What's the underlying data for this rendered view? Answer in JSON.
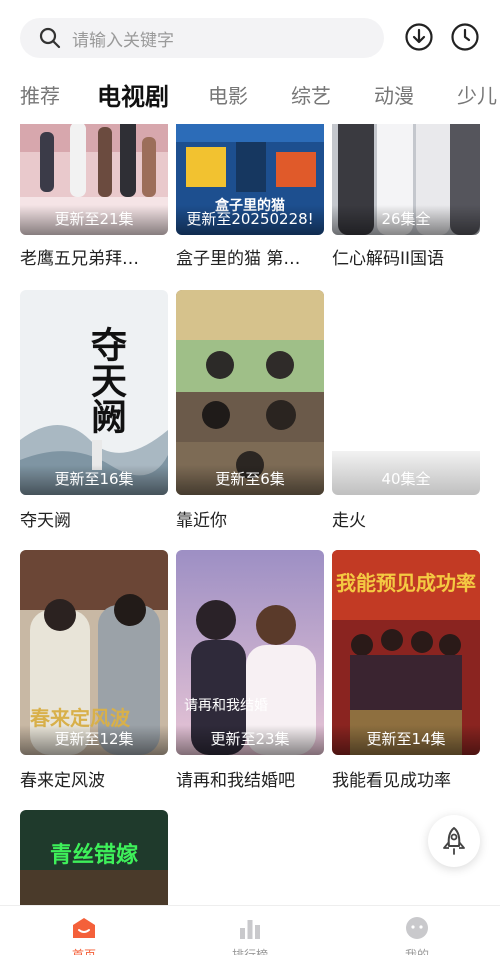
{
  "search": {
    "placeholder": "请输入关键字"
  },
  "header_icons": {
    "download": "download-icon",
    "history": "clock-icon"
  },
  "tabs": [
    {
      "label": "推荐",
      "active": false
    },
    {
      "label": "电视剧",
      "active": true
    },
    {
      "label": "电影",
      "active": false
    },
    {
      "label": "综艺",
      "active": false
    },
    {
      "label": "动漫",
      "active": false
    },
    {
      "label": "少儿",
      "active": false
    }
  ],
  "cards": [
    {
      "title": "老鹰五兄弟拜…",
      "badge": "更新至21集"
    },
    {
      "title": "盒子里的猫 第…",
      "badge": "更新至20250228!",
      "poster_text": "盒子里的猫"
    },
    {
      "title": "仁心解码II国语",
      "badge": "26集全"
    },
    {
      "title": "夺天阙",
      "badge": "更新至16集",
      "poster_text": "夺天阙"
    },
    {
      "title": "靠近你",
      "badge": "更新至6集"
    },
    {
      "title": "走火",
      "badge": "40集全"
    },
    {
      "title": "春来定风波",
      "badge": "更新至12集",
      "poster_text": "春来定风波"
    },
    {
      "title": "请再和我结婚吧",
      "badge": "更新至23集",
      "poster_text": "请再和我结婚"
    },
    {
      "title": "我能看见成功率",
      "badge": "更新至14集",
      "poster_text": "我能预见成功率"
    },
    {
      "title": "",
      "badge": "",
      "poster_text": "青丝错嫁"
    }
  ],
  "colors": {
    "accent": "#f4603a",
    "badge_text": "#ffffff",
    "inactive_tab": "#777777"
  },
  "bottom_nav": [
    {
      "label": "首页",
      "icon": "home-icon",
      "active": true
    },
    {
      "label": "排行榜",
      "icon": "rank-chart-icon",
      "active": false
    },
    {
      "label": "我的",
      "icon": "profile-icon",
      "active": false
    }
  ],
  "float_button": {
    "icon": "rocket-icon"
  }
}
